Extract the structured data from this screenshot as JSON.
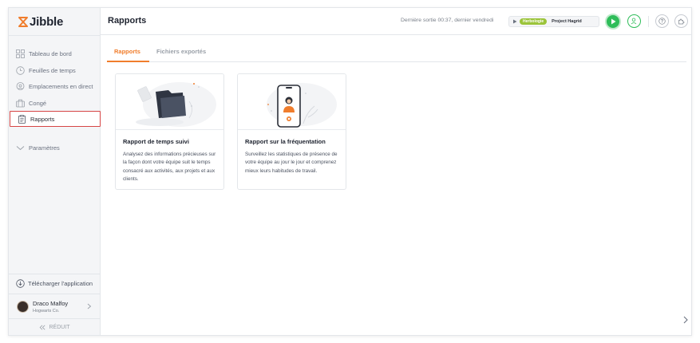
{
  "app": {
    "name": "Jibble"
  },
  "sidebar": {
    "items": [
      {
        "label": "Tableau de bord",
        "icon": "dashboard-icon"
      },
      {
        "label": "Feuilles de temps",
        "icon": "clock-icon"
      },
      {
        "label": "Emplacements en direct",
        "icon": "location-pin-icon"
      },
      {
        "label": "Congé",
        "icon": "suitcase-icon"
      },
      {
        "label": "Rapports",
        "icon": "clipboard-icon",
        "active": true
      },
      {
        "label": "Paramètres",
        "icon": "chevron-down-icon"
      }
    ],
    "download_label": "Télécharger l'application",
    "user": {
      "name": "Draco Malfoy",
      "org": "Hogwarts Co."
    },
    "collapse_label": "RÉDUIT"
  },
  "header": {
    "title": "Rapports",
    "last_exit": "Dernière sortie 00:37, dernier vendredi",
    "activity_tag": "Herbologie",
    "project": "Project Hagrid"
  },
  "tabs": [
    {
      "label": "Rapports",
      "active": true
    },
    {
      "label": "Fichiers exportés",
      "active": false
    }
  ],
  "cards": [
    {
      "title": "Rapport de temps suivi",
      "description": "Analysez des informations précieuses sur la façon dont votre équipe suit le temps consacré aux activités, aux projets et aux clients."
    },
    {
      "title": "Rapport sur la fréquentation",
      "description": "Surveillez les statistiques de présence de votre équipe au jour le jour et comprenez mieux leurs habitudes de travail."
    }
  ],
  "colors": {
    "accent": "#f07d2c",
    "play": "#2ebd59",
    "activity_tag": "#9bc43a",
    "active_outline": "#d64545"
  }
}
